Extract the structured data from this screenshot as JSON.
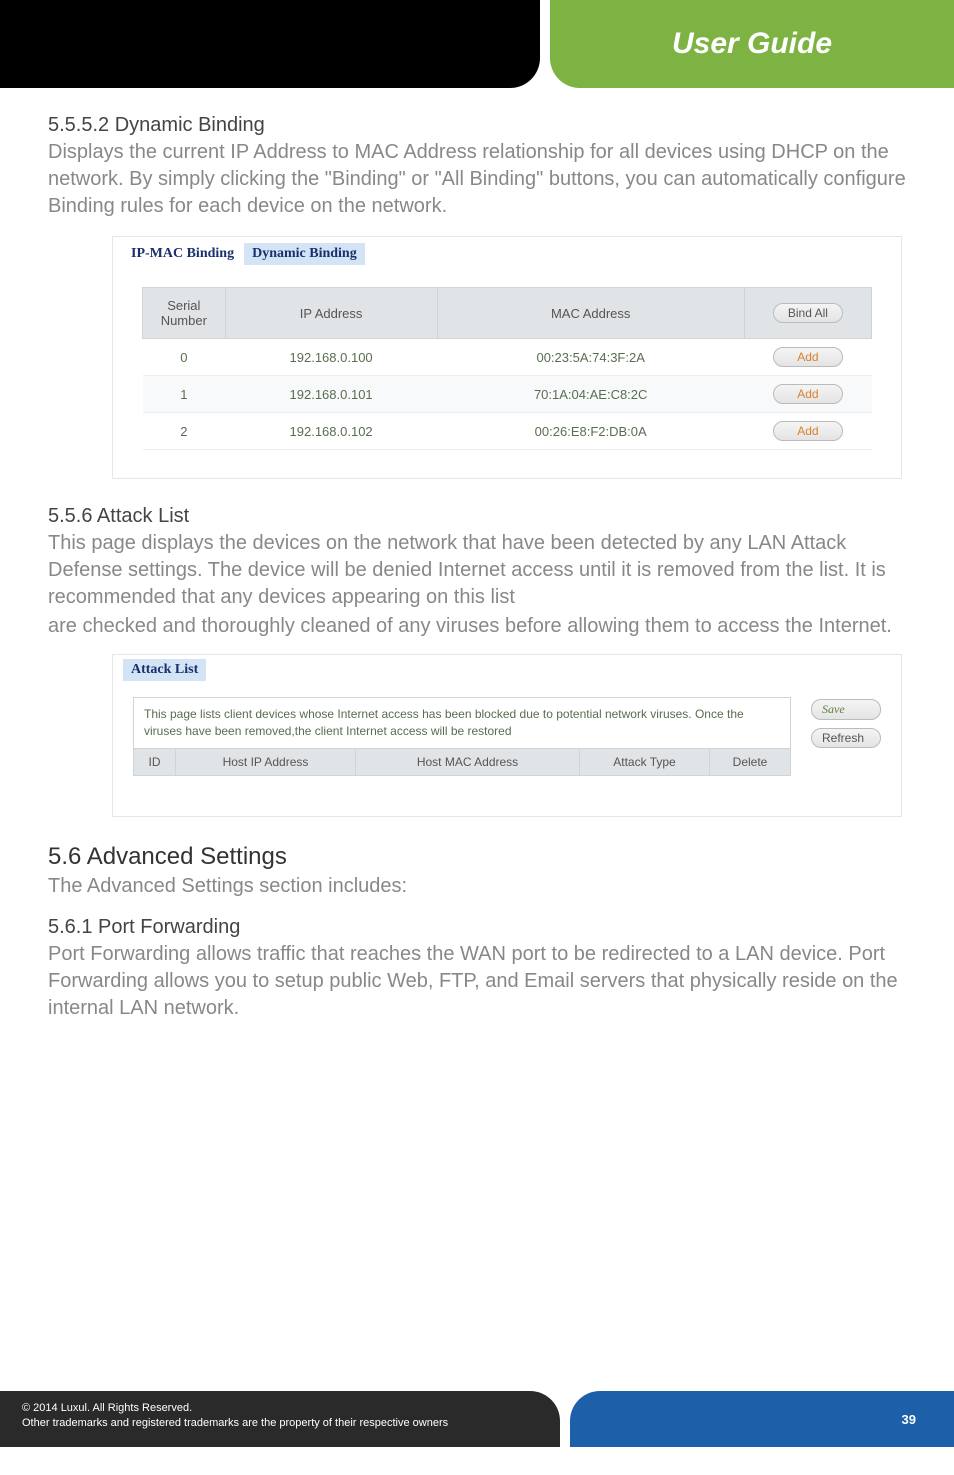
{
  "banner": {
    "title": "User Guide"
  },
  "sec1": {
    "heading": "5.5.5.2 Dynamic Binding",
    "body": "Displays the current IP Address to MAC Address relationship for all devices using DHCP on the network. By simply clicking the \"Binding\" or \"All Binding\" buttons, you can automatically configure Binding rules for each device on the network."
  },
  "binding_panel": {
    "tabs": {
      "inactive": "IP-MAC Binding",
      "active": "Dynamic Binding"
    },
    "headers": {
      "serial": "Serial Number",
      "ip": "IP Address",
      "mac": "MAC Address",
      "bind_all": "Bind All"
    },
    "rows": [
      {
        "serial": "0",
        "ip": "192.168.0.100",
        "mac": "00:23:5A:74:3F:2A",
        "action": "Add"
      },
      {
        "serial": "1",
        "ip": "192.168.0.101",
        "mac": "70:1A:04:AE:C8:2C",
        "action": "Add"
      },
      {
        "serial": "2",
        "ip": "192.168.0.102",
        "mac": "00:26:E8:F2:DB:0A",
        "action": "Add"
      }
    ]
  },
  "sec2": {
    "heading": "5.5.6 Attack List",
    "body1": "This page displays the devices on the network that have been detected by any LAN Attack Defense settings. The device will be denied Internet access until it is removed from the list. It is recommended that any devices appearing on this list",
    "body2": "are checked and thoroughly cleaned of any viruses before allowing them to access the Internet."
  },
  "attack_panel": {
    "tab": "Attack List",
    "desc": "This page lists client devices whose Internet access has been blocked due to potential network viruses. Once the viruses have been removed,the client Internet access will be restored",
    "headers": {
      "id": "ID",
      "ip": "Host IP Address",
      "mac": "Host MAC Address",
      "type": "Attack Type",
      "del": "Delete"
    },
    "buttons": {
      "save": "Save",
      "refresh": "Refresh"
    }
  },
  "sec3": {
    "heading": "5.6 Advanced Settings",
    "body": "The Advanced Settings section includes:"
  },
  "sec4": {
    "heading": "5.6.1 Port Forwarding",
    "body": "Port Forwarding allows traffic that reaches the WAN port to be redirected to a LAN device. Port Forwarding allows you to setup public Web, FTP, and Email servers that physically reside on the internal LAN network."
  },
  "footer": {
    "copyright": "© 2014  Luxul. All Rights Reserved.",
    "trademark": "Other trademarks and registered trademarks are the property of their respective owners",
    "page": "39"
  }
}
